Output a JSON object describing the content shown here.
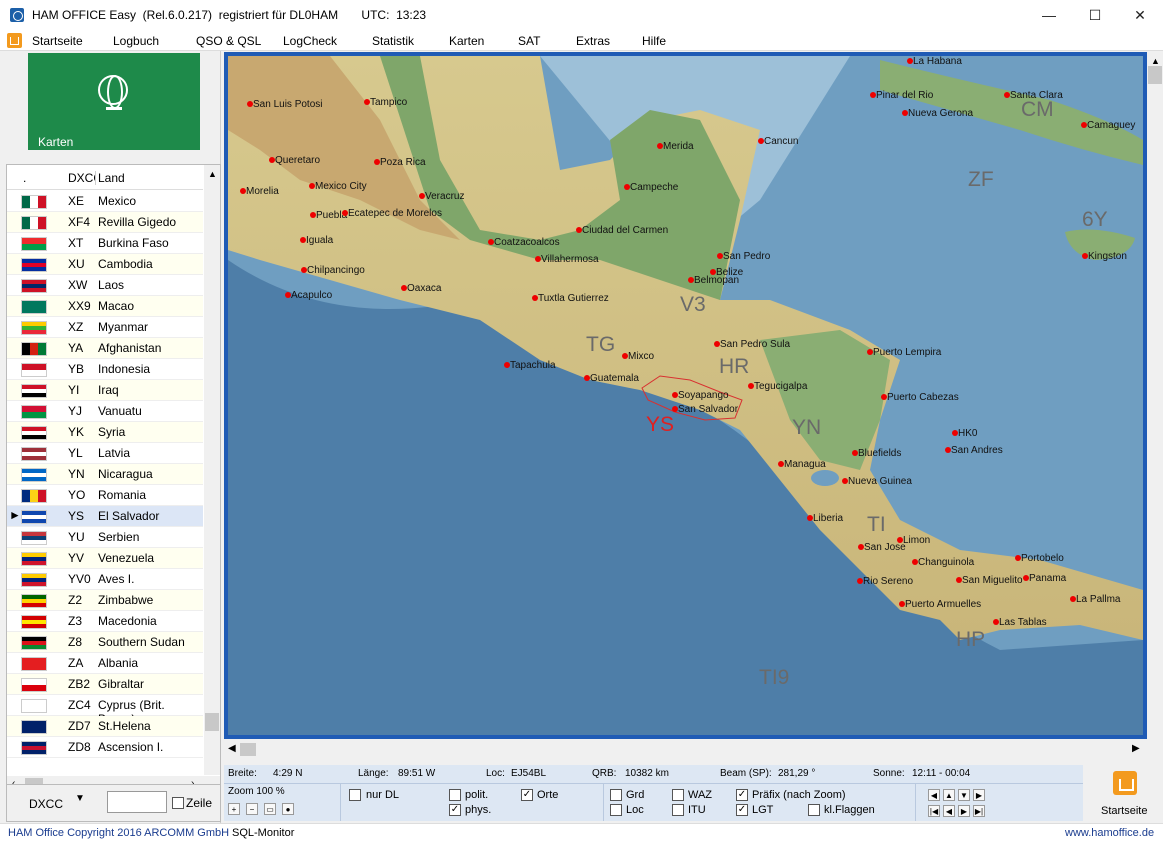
{
  "window": {
    "title": "HAM OFFICE Easy  (Rel.6.0.217)  registriert für DL0HAM       UTC:  13:23",
    "minimize": "—",
    "maximize": "☐",
    "close": "✕"
  },
  "menu": [
    "Startseite",
    "Logbuch",
    "QSO & QSL",
    "LogCheck",
    "Statistik",
    "Karten",
    "SAT",
    "Extras",
    "Hilfe"
  ],
  "tile": {
    "label": "Karten"
  },
  "list": {
    "headers": {
      "dot": ".",
      "dxcc": "DXCC",
      "land": "Land"
    },
    "rows": [
      {
        "p": "XE",
        "l": "Mexico",
        "f": [
          "#006847",
          "#fff",
          "#ce1126"
        ],
        "v": 1
      },
      {
        "p": "XF4",
        "l": "Revilla Gigedo",
        "f": [
          "#006847",
          "#fff",
          "#ce1126"
        ],
        "v": 1
      },
      {
        "p": "XT",
        "l": "Burkina Faso",
        "f": [
          "#ef2b2d",
          "#009e49"
        ],
        "v": 0
      },
      {
        "p": "XU",
        "l": "Cambodia",
        "f": [
          "#032ea1",
          "#e00025",
          "#032ea1"
        ],
        "v": 0
      },
      {
        "p": "XW",
        "l": "Laos",
        "f": [
          "#ce1126",
          "#002868",
          "#ce1126"
        ],
        "v": 0
      },
      {
        "p": "XX9",
        "l": "Macao",
        "f": [
          "#00785e",
          "#00785e"
        ],
        "v": 0
      },
      {
        "p": "XZ",
        "l": "Myanmar",
        "f": [
          "#fecb00",
          "#34b233",
          "#ea2839"
        ],
        "v": 0
      },
      {
        "p": "YA",
        "l": "Afghanistan",
        "f": [
          "#000",
          "#d32011",
          "#007a36"
        ],
        "v": 1
      },
      {
        "p": "YB",
        "l": "Indonesia",
        "f": [
          "#ce1126",
          "#fff"
        ],
        "v": 0
      },
      {
        "p": "YI",
        "l": "Iraq",
        "f": [
          "#ce1126",
          "#fff",
          "#000"
        ],
        "v": 0
      },
      {
        "p": "YJ",
        "l": "Vanuatu",
        "f": [
          "#d21034",
          "#009543"
        ],
        "v": 0
      },
      {
        "p": "YK",
        "l": "Syria",
        "f": [
          "#ce1126",
          "#fff",
          "#000"
        ],
        "v": 0
      },
      {
        "p": "YL",
        "l": "Latvia",
        "f": [
          "#9e3039",
          "#fff",
          "#9e3039"
        ],
        "v": 0
      },
      {
        "p": "YN",
        "l": "Nicaragua",
        "f": [
          "#0067c6",
          "#fff",
          "#0067c6"
        ],
        "v": 0
      },
      {
        "p": "YO",
        "l": "Romania",
        "f": [
          "#002b7f",
          "#fcd116",
          "#ce1126"
        ],
        "v": 1
      },
      {
        "p": "YS",
        "l": "El Salvador",
        "f": [
          "#0f47af",
          "#fff",
          "#0f47af"
        ],
        "v": 0
      },
      {
        "p": "YU",
        "l": "Serbien",
        "f": [
          "#c6363c",
          "#0c4076",
          "#fff"
        ],
        "v": 0
      },
      {
        "p": "YV",
        "l": "Venezuela",
        "f": [
          "#ffcc00",
          "#00247d",
          "#cf142b"
        ],
        "v": 0
      },
      {
        "p": "YV0",
        "l": "Aves I.",
        "f": [
          "#ffcc00",
          "#00247d",
          "#cf142b"
        ],
        "v": 0
      },
      {
        "p": "Z2",
        "l": "Zimbabwe",
        "f": [
          "#006400",
          "#ffd200",
          "#d40000"
        ],
        "v": 0
      },
      {
        "p": "Z3",
        "l": "Macedonia",
        "f": [
          "#d20000",
          "#ffe600",
          "#d20000"
        ],
        "v": 0
      },
      {
        "p": "Z8",
        "l": "Southern Sudan",
        "f": [
          "#000",
          "#da121a",
          "#078930"
        ],
        "v": 0
      },
      {
        "p": "ZA",
        "l": "Albania",
        "f": [
          "#e41e20",
          "#e41e20"
        ],
        "v": 0
      },
      {
        "p": "ZB2",
        "l": "Gibraltar",
        "f": [
          "#fff",
          "#da000c"
        ],
        "v": 0
      },
      {
        "p": "ZC4",
        "l": "Cyprus (Brit. Bases)",
        "f": [
          "#fff",
          "#fff"
        ],
        "v": 0
      },
      {
        "p": "ZD7",
        "l": "St.Helena",
        "f": [
          "#012169",
          "#012169"
        ],
        "v": 0
      },
      {
        "p": "ZD8",
        "l": "Ascension I.",
        "f": [
          "#012169",
          "#c8102e",
          "#012169"
        ],
        "v": 0
      }
    ],
    "selected": "YS"
  },
  "controls": {
    "mode": "DXCC",
    "zeile": "Zeile"
  },
  "map": {
    "labels": [
      [
        "San Luis Potosi",
        253,
        99
      ],
      [
        "Tampico",
        370,
        97
      ],
      [
        "Queretaro",
        275,
        155
      ],
      [
        "Poza Rica",
        380,
        157
      ],
      [
        "Morelia",
        246,
        186
      ],
      [
        "Mexico City",
        315,
        181
      ],
      [
        "Veracruz",
        425,
        191
      ],
      [
        "Puebla",
        316,
        210
      ],
      [
        "Ecatepec de Morelos",
        348,
        208
      ],
      [
        "Iguala",
        306,
        235
      ],
      [
        "Chilpancingo",
        307,
        265
      ],
      [
        "Acapulco",
        291,
        290
      ],
      [
        "Oaxaca",
        407,
        283
      ],
      [
        "Coatzacoalcos",
        494,
        237
      ],
      [
        "Villahermosa",
        541,
        254
      ],
      [
        "Tuxtla Gutierrez",
        538,
        293
      ],
      [
        "Tapachula",
        510,
        360
      ],
      [
        "Mixco",
        628,
        351
      ],
      [
        "Guatemala",
        590,
        373
      ],
      [
        "Soyapango",
        678,
        390
      ],
      [
        "San Salvador",
        678,
        404
      ],
      [
        "Merida",
        663,
        141
      ],
      [
        "Cancun",
        764,
        136
      ],
      [
        "Campeche",
        630,
        182
      ],
      [
        "Ciudad del Carmen",
        582,
        225
      ],
      [
        "San Pedro",
        723,
        251
      ],
      [
        "Belize",
        716,
        267
      ],
      [
        "Belmopan",
        694,
        275
      ],
      [
        "San Pedro Sula",
        720,
        339
      ],
      [
        "Tegucigalpa",
        754,
        381
      ],
      [
        "Puerto Lempira",
        873,
        347
      ],
      [
        "Puerto Cabezas",
        887,
        392
      ],
      [
        "San Andres",
        951,
        445
      ],
      [
        "HK0",
        958,
        428
      ],
      [
        "Managua",
        784,
        459
      ],
      [
        "Bluefields",
        858,
        448
      ],
      [
        "Nueva Guinea",
        848,
        476
      ],
      [
        "Liberia",
        813,
        513
      ],
      [
        "Limon",
        903,
        535
      ],
      [
        "San Jose",
        864,
        542
      ],
      [
        "Changuinola",
        918,
        557
      ],
      [
        "Rio Sereno",
        863,
        576
      ],
      [
        "San Miguelito",
        962,
        575
      ],
      [
        "Panama",
        1029,
        573
      ],
      [
        "Portobelo",
        1021,
        553
      ],
      [
        "Puerto Armuelles",
        905,
        599
      ],
      [
        "Las Tablas",
        999,
        617
      ],
      [
        "La Pallma",
        1076,
        594
      ],
      [
        "La Habana",
        913,
        56
      ],
      [
        "Pinar del Rio",
        876,
        90
      ],
      [
        "Nueva Gerona",
        908,
        108
      ],
      [
        "Santa Clara",
        1010,
        90
      ],
      [
        "Camaguey",
        1087,
        120
      ],
      [
        "Kingston",
        1088,
        251
      ]
    ],
    "prefixes": [
      [
        "CM",
        1021,
        98
      ],
      [
        "ZF",
        968,
        168
      ],
      [
        "6Y",
        1082,
        208
      ],
      [
        "V3",
        680,
        293
      ],
      [
        "TG",
        586,
        333
      ],
      [
        "HR",
        719,
        355
      ],
      [
        "YS",
        646,
        413
      ],
      [
        "YN",
        792,
        416
      ],
      [
        "TI",
        867,
        513
      ],
      [
        "HP",
        956,
        628
      ],
      [
        "TI9",
        759,
        666
      ]
    ]
  },
  "info": {
    "breite_l": "Breite:",
    "breite": "4:29 N",
    "laenge_l": "Länge:",
    "laenge": "89:51 W",
    "loc_l": "Loc:",
    "loc": "EJ54BL",
    "qrb_l": "QRB:",
    "qrb": "10382 km",
    "beam_l": "Beam (SP):",
    "beam": "281,29 °",
    "sonne_l": "Sonne:",
    "sonne": "12:11 - 00:04"
  },
  "options": {
    "zoom": "Zoom  100 %",
    "nurdl": "nur DL",
    "polit": "polit.",
    "phys": "phys.",
    "orte": "Orte",
    "grd": "Grd",
    "loc": "Loc",
    "waz": "WAZ",
    "itu": "ITU",
    "praefix": "Präfix (nach Zoom)",
    "lgt": "LGT",
    "klflaggen": "kl.Flaggen"
  },
  "startseite": "Startseite",
  "status": {
    "copyright": "HAM Office Copyright 2016 ARCOMM GmbH",
    "monitor": "SQL-Monitor",
    "web": "www.hamoffice.de"
  }
}
